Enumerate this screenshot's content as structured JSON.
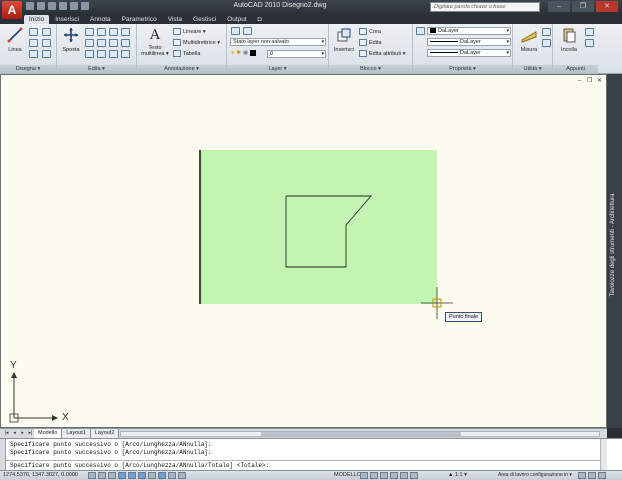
{
  "window": {
    "title": "AutoCAD 2010    Disegno2.dwg",
    "search_placeholder": "Digitare parola chiave o frase",
    "minimize": "–",
    "restore": "❐",
    "close": "✕"
  },
  "app_button": "A",
  "ribbon_tabs": [
    "Inizio",
    "Inserisci",
    "Annota",
    "Parametrico",
    "Vista",
    "Gestisci",
    "Output",
    "◘"
  ],
  "active_tab": "Inizio",
  "ribbon": {
    "disegna": {
      "label": "Disegna ▾",
      "linea": "Linea"
    },
    "edita": {
      "label": "Edita ▾",
      "sposta": "Sposta"
    },
    "annotazione": {
      "label": "Annotazione ▾",
      "testo_line1": "Testo",
      "testo_line2": "multilinea ▾",
      "lineare": "Lineare ▾",
      "multidirettrice": "Multidirettrice ▾",
      "tabella": "Tabella"
    },
    "layer": {
      "label": "Layer ▾",
      "state": "Stato layer non salvato",
      "current": "0"
    },
    "blocco": {
      "label": "Blocco ▾",
      "inserisci": "Inserisci",
      "crea": "Crea",
      "edita": "Edita",
      "edita_attributi": "Edita attributi ▾"
    },
    "proprieta": {
      "label": "Proprietà ▾",
      "color": "DaLayer",
      "linetype": "DaLayer",
      "lineweight": "DaLayer"
    },
    "utilita": {
      "label": "Utilità ▾",
      "misura": "Misura"
    },
    "appunti": {
      "label": "Appunti",
      "incolla": "Incolla"
    }
  },
  "drawing": {
    "tooltip": "Punto finale",
    "ucs_x": "X",
    "ucs_y": "Y",
    "palette_title": "Tavolozze degli strumenti - Architettura",
    "vp_minimize": "–",
    "vp_restore": "❐",
    "vp_close": "✕"
  },
  "layout_tabs": [
    "Modello",
    "Layout1",
    "Layout2"
  ],
  "layout_nav": [
    "|◂",
    "◂",
    "▸",
    "▸|"
  ],
  "command_lines": [
    "Specificare punto successivo o [Arco/Lunghezza/ANnulla]:",
    "Specificare punto successivo o [Arco/Lunghezza/ANnulla]:",
    "Specificare punto successivo o [Arco/Lunghezza/ANnulla/Totale] <Totale>:"
  ],
  "status": {
    "coords": "1274.5376, 1347.3027, 0.0000",
    "model": "MODELLO",
    "scale": "▲ 1:1 ▾",
    "workspace": "Area di lavoro configurazione in ▾"
  },
  "colors": {
    "canvas": "#fdfcf0",
    "region_fill": "#c2f5b1",
    "ribbon": "#e3e8ee",
    "titlebar": "#2b3038"
  }
}
